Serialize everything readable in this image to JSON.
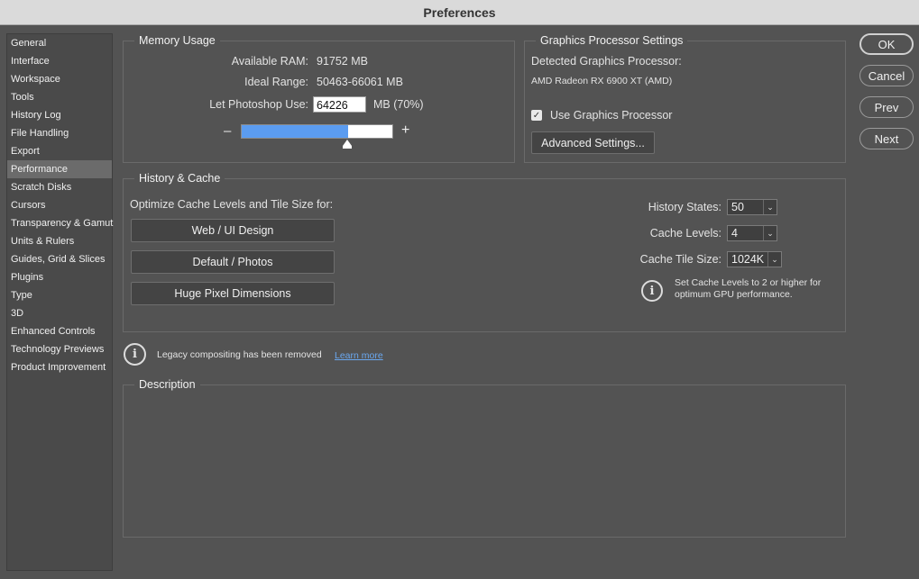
{
  "window": {
    "title": "Preferences"
  },
  "sidebar": {
    "items": [
      {
        "label": "General"
      },
      {
        "label": "Interface"
      },
      {
        "label": "Workspace"
      },
      {
        "label": "Tools"
      },
      {
        "label": "History Log"
      },
      {
        "label": "File Handling"
      },
      {
        "label": "Export"
      },
      {
        "label": "Performance"
      },
      {
        "label": "Scratch Disks"
      },
      {
        "label": "Cursors"
      },
      {
        "label": "Transparency & Gamut"
      },
      {
        "label": "Units & Rulers"
      },
      {
        "label": "Guides, Grid & Slices"
      },
      {
        "label": "Plugins"
      },
      {
        "label": "Type"
      },
      {
        "label": "3D"
      },
      {
        "label": "Enhanced Controls"
      },
      {
        "label": "Technology Previews"
      },
      {
        "label": "Product Improvement"
      }
    ],
    "selected": "Performance"
  },
  "memory": {
    "title": "Memory Usage",
    "available_label": "Available RAM:",
    "available_value": "91752 MB",
    "ideal_label": "Ideal Range:",
    "ideal_value": "50463-66061 MB",
    "use_label": "Let Photoshop Use:",
    "use_value": "64226",
    "use_suffix": "MB (70%)",
    "usage_fraction": 0.7,
    "minus": "–",
    "plus": "+"
  },
  "gpu": {
    "title": "Graphics Processor Settings",
    "detected_label": "Detected Graphics Processor:",
    "detected_value": "AMD Radeon RX 6900 XT (AMD)",
    "use_gpu_label": "Use Graphics Processor",
    "use_gpu_checked": true,
    "advanced_button": "Advanced Settings..."
  },
  "history_cache": {
    "title": "History & Cache",
    "optimize_label": "Optimize Cache Levels and Tile Size for:",
    "presets": [
      "Web / UI Design",
      "Default / Photos",
      "Huge Pixel Dimensions"
    ],
    "history_states_label": "History States:",
    "history_states_value": "50",
    "cache_levels_label": "Cache Levels:",
    "cache_levels_value": "4",
    "tile_size_label": "Cache Tile Size:",
    "tile_size_value": "1024K",
    "gpu_note_line1": "Set Cache Levels to 2 or higher for",
    "gpu_note_line2": "optimum GPU performance."
  },
  "legacy": {
    "message": "Legacy compositing has been removed",
    "link": "Learn more"
  },
  "description": {
    "title": "Description"
  },
  "buttons": {
    "ok": "OK",
    "cancel": "Cancel",
    "prev": "Prev",
    "next": "Next"
  },
  "icons": {
    "info": "i",
    "checkmark": "✓",
    "chevron": "⌄"
  }
}
